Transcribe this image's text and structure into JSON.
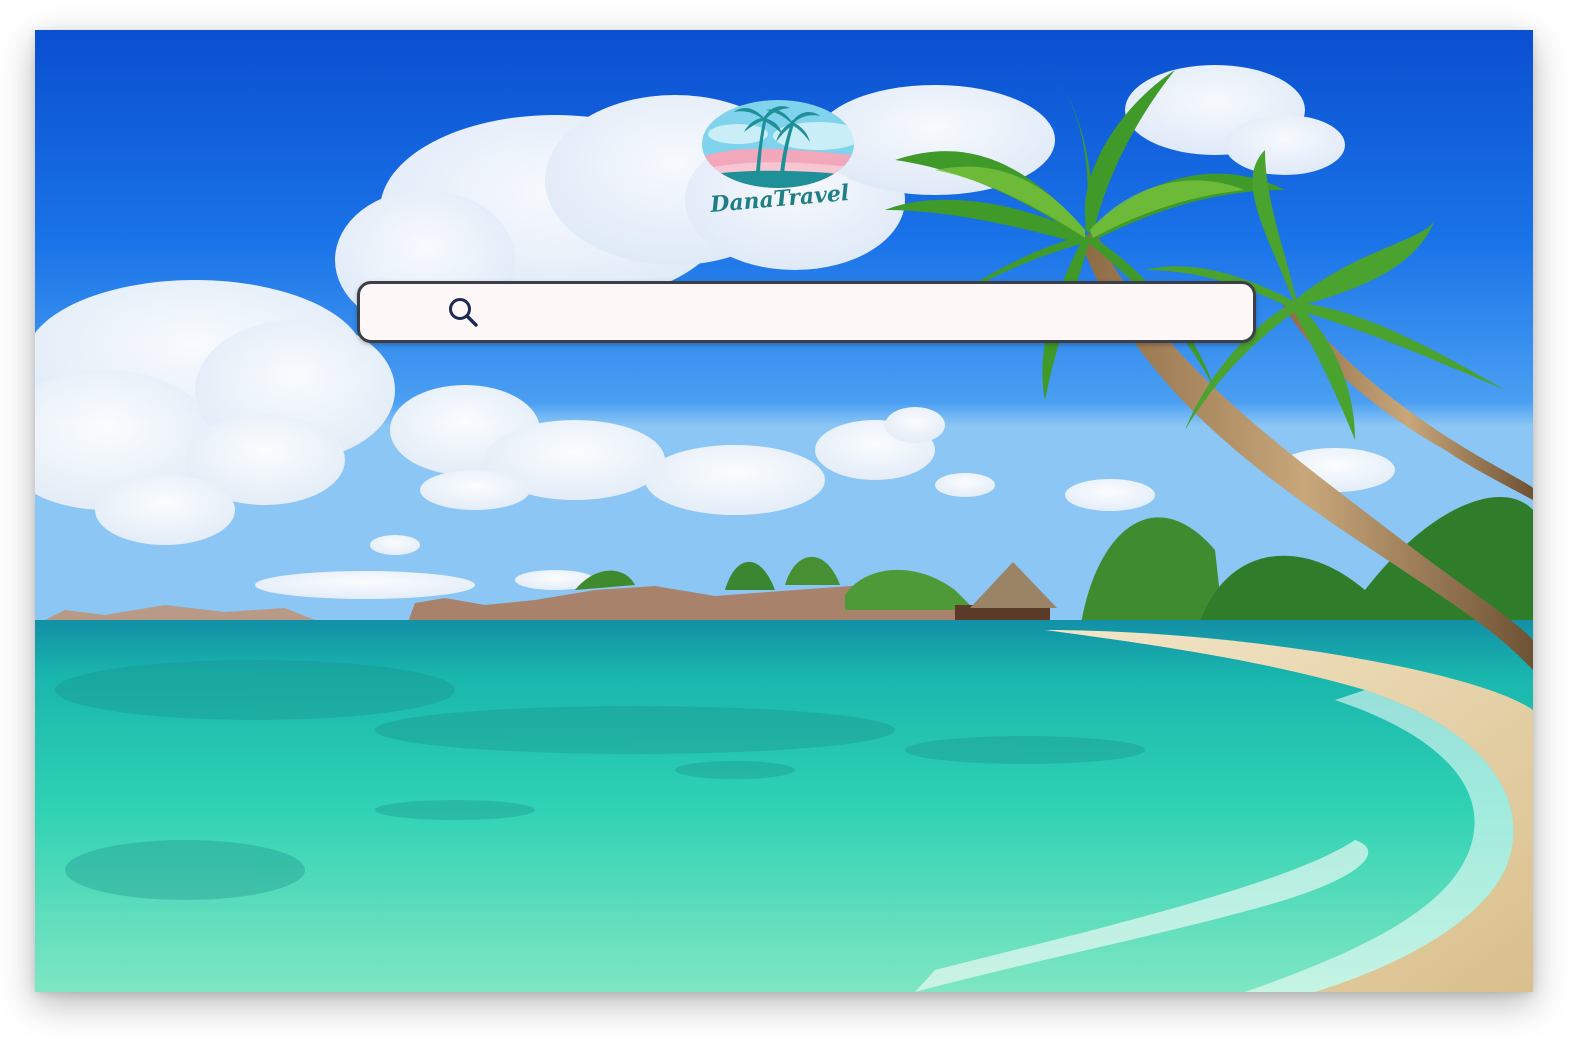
{
  "brand": {
    "name": "DanaTravel",
    "colors": {
      "teal": "#1f8f98",
      "pink": "#f2a7bb",
      "sky": "#7fd3ec",
      "navy": "#1d2a55"
    }
  },
  "background": {
    "subject": "tropical-beach-photo",
    "colors": {
      "sky_top": "#0d55d6",
      "sky_low": "#5aa9f0",
      "sea": "#2fd6b6",
      "sand": "#ecd9b0"
    }
  },
  "search": {
    "icon": "search-icon",
    "placeholder": "",
    "value": "",
    "border_color": "#3c3f45",
    "fill_color": "#fdf8f7"
  }
}
